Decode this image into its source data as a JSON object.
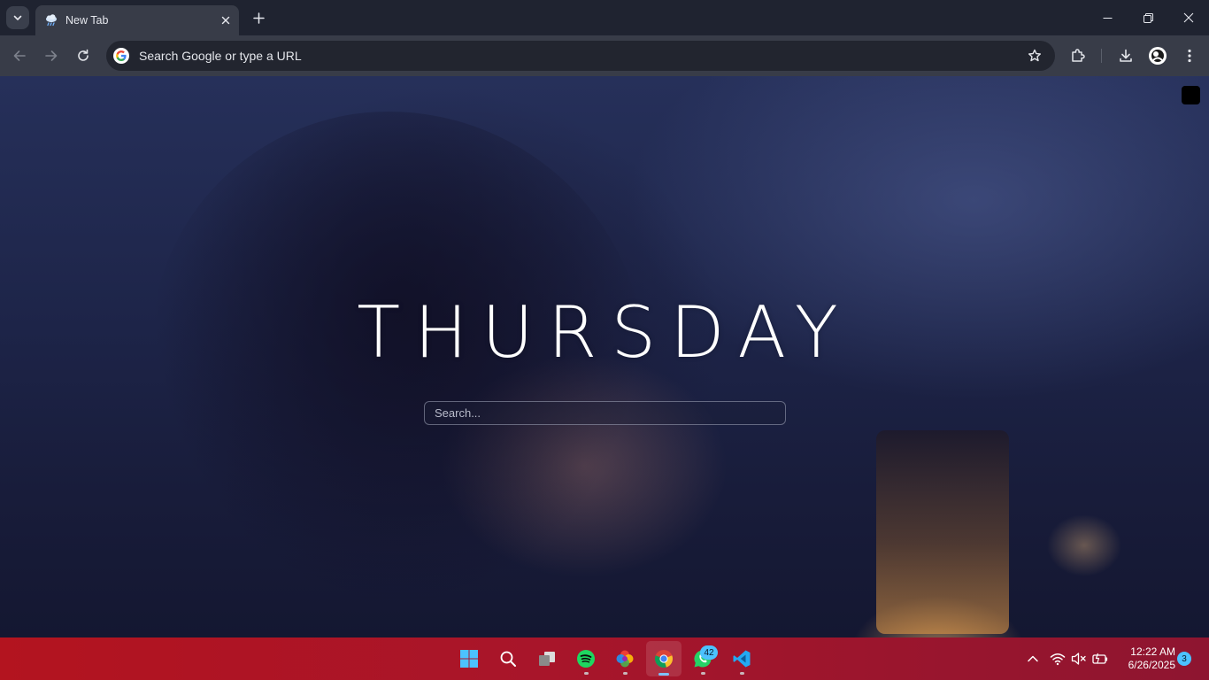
{
  "browser": {
    "tab": {
      "title": "New Tab",
      "favicon": "cloud-rain-icon"
    },
    "omnibox": {
      "placeholder": "Search Google or type a URL"
    },
    "toolbar_icons": [
      "back-icon",
      "forward-icon",
      "reload-icon",
      "star-icon",
      "extensions-icon",
      "download-icon",
      "profile-icon",
      "menu-icon"
    ],
    "window_controls": [
      "minimize-icon",
      "restore-icon",
      "close-icon"
    ]
  },
  "page": {
    "day": "THURSDAY",
    "search_placeholder": "Search..."
  },
  "taskbar": {
    "apps": [
      {
        "name": "Start",
        "icon": "windows-start-icon"
      },
      {
        "name": "Search",
        "icon": "search-icon"
      },
      {
        "name": "Task View",
        "icon": "task-view-icon"
      },
      {
        "name": "Spotify",
        "icon": "spotify-icon"
      },
      {
        "name": "Photos",
        "icon": "color-wheel-icon"
      },
      {
        "name": "Chrome",
        "icon": "chrome-icon",
        "active": true
      },
      {
        "name": "WhatsApp",
        "icon": "whatsapp-icon",
        "badge": "42"
      },
      {
        "name": "VS Code",
        "icon": "vscode-icon"
      }
    ],
    "tray_icons": [
      "chevron-up-icon",
      "wifi-icon",
      "speaker-muted-icon",
      "battery-icon"
    ],
    "time": "12:22 AM",
    "date": "6/26/2025",
    "notification_count": "3",
    "colors": {
      "taskbar": "#b3141f",
      "accent": "#4cc2ff"
    }
  }
}
